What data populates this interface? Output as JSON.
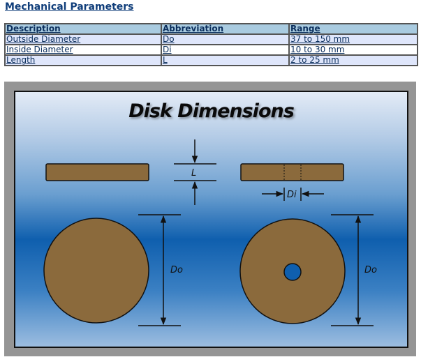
{
  "section": {
    "title": "Mechanical Parameters"
  },
  "table": {
    "headers": [
      "Description",
      "Abbreviation",
      "Range"
    ],
    "rows": [
      [
        "Outside Diameter",
        "Do",
        "37 to 150 mm"
      ],
      [
        "Inside Diameter",
        "Di",
        "10 to 30 mm"
      ],
      [
        "Length",
        "L",
        "2 to 25 mm"
      ]
    ]
  },
  "figure": {
    "title": "Disk Dimensions",
    "labels": {
      "length": "L",
      "inside_diameter": "Di",
      "outside_diameter_left": "Do",
      "outside_diameter_right": "Do"
    },
    "colors": {
      "disk_fill": "#8b6a3c",
      "outline": "#111111",
      "frame": "#959595"
    }
  }
}
